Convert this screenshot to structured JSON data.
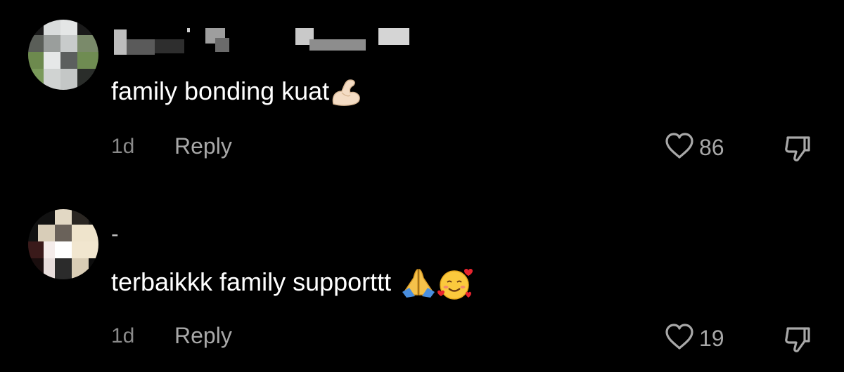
{
  "comments": [
    {
      "username": "",
      "text": "family bonding kuat",
      "emojis": [
        "flexed-biceps"
      ],
      "time": "1d",
      "reply_label": "Reply",
      "likes": "86"
    },
    {
      "username": "-",
      "text": "terbaikkk family supporttt",
      "emojis": [
        "folded-hands",
        "smiling-face-with-hearts"
      ],
      "time": "1d",
      "reply_label": "Reply",
      "likes": "19"
    }
  ],
  "colors": {
    "background": "#000000",
    "text": "#ffffff",
    "secondary_text": "#a8a8a8",
    "time_text": "#8a8a8a"
  }
}
